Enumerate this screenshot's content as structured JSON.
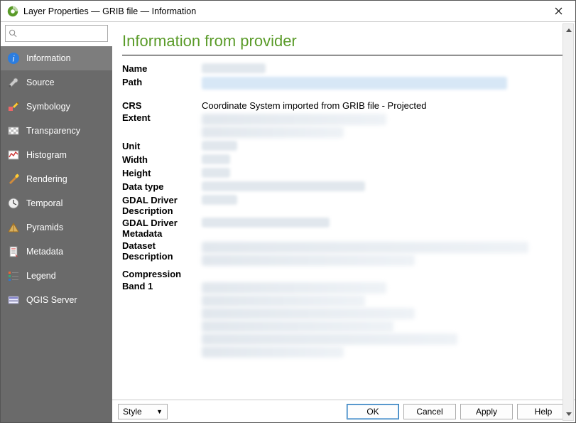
{
  "window": {
    "title": "Layer Properties — GRIB file — Information"
  },
  "search": {
    "placeholder": ""
  },
  "sidebar": {
    "items": [
      {
        "label": "Information",
        "icon": "info-icon",
        "active": true
      },
      {
        "label": "Source",
        "icon": "wrench-icon"
      },
      {
        "label": "Symbology",
        "icon": "brush-icon"
      },
      {
        "label": "Transparency",
        "icon": "transparency-icon"
      },
      {
        "label": "Histogram",
        "icon": "chart-icon"
      },
      {
        "label": "Rendering",
        "icon": "paint-icon"
      },
      {
        "label": "Temporal",
        "icon": "clock-icon"
      },
      {
        "label": "Pyramids",
        "icon": "pyramid-icon"
      },
      {
        "label": "Metadata",
        "icon": "doc-icon"
      },
      {
        "label": "Legend",
        "icon": "legend-icon"
      },
      {
        "label": "QGIS Server",
        "icon": "server-icon"
      }
    ]
  },
  "main": {
    "section_title": "Information from provider",
    "rows": [
      {
        "key": "Name",
        "value": ""
      },
      {
        "key": "Path",
        "value": ""
      },
      {
        "key": "CRS",
        "value": "Coordinate System imported from GRIB file - Projected"
      },
      {
        "key": "Extent",
        "value": ""
      },
      {
        "key": "Unit",
        "value": ""
      },
      {
        "key": "Width",
        "value": ""
      },
      {
        "key": "Height",
        "value": ""
      },
      {
        "key": "Data type",
        "value": ""
      },
      {
        "key": "GDAL Driver Description",
        "value": ""
      },
      {
        "key": "GDAL Driver Metadata",
        "value": ""
      },
      {
        "key": "Dataset Description",
        "value": ""
      },
      {
        "key": "Compression",
        "value": ""
      },
      {
        "key": "Band 1",
        "value": ""
      }
    ]
  },
  "footer": {
    "style": "Style",
    "ok": "OK",
    "cancel": "Cancel",
    "apply": "Apply",
    "help": "Help"
  }
}
